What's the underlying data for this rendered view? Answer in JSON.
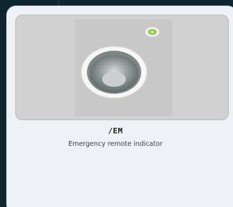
{
  "product": {
    "code": "/EM",
    "description": "Emergency remote indicator",
    "image_subject": "recessed-downlight-with-green-indicator"
  },
  "colors": {
    "page_background": "#0f2530",
    "card_background": "#eef2f6",
    "image_background": "#d1d1d1",
    "indicator_green": "#8fd14f"
  }
}
